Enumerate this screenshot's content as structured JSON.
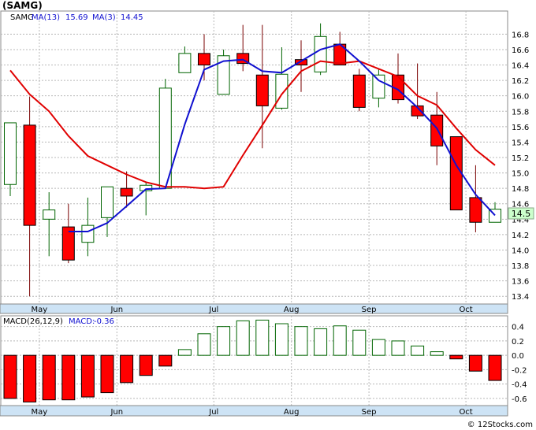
{
  "chart_data": [
    {
      "type": "candlestick",
      "title": "(SAMG)",
      "legend": [
        {
          "label": "SAMG",
          "value": "",
          "color": "#000000"
        },
        {
          "label": "MA(13)",
          "value": "15.69",
          "color": "#e00000"
        },
        {
          "label": "MA(3)",
          "value": "14.45",
          "color": "#1010d0"
        }
      ],
      "last_price_label": "14.5",
      "ylim": [
        13.3,
        17.1
      ],
      "yticks": [
        "13.4",
        "13.6",
        "13.8",
        "14.0",
        "14.2",
        "14.4",
        "14.6",
        "14.8",
        "15.0",
        "15.2",
        "15.4",
        "15.6",
        "15.8",
        "16.0",
        "16.2",
        "16.4",
        "16.6",
        "16.8"
      ],
      "months": [
        "May",
        "Jun",
        "Jul",
        "Aug",
        "Sep",
        "Oct"
      ],
      "month_index": [
        1,
        5,
        10,
        14,
        18,
        23
      ],
      "colors": {
        "up_fill": "#ffffff",
        "up_border": "#006400",
        "down_fill": "#ff0000",
        "ma13": "#e00000",
        "ma3": "#1010d0",
        "label_bg": "#ccffcc"
      },
      "candles": [
        {
          "o": 14.85,
          "h": 15.65,
          "l": 14.7,
          "c": 15.65
        },
        {
          "o": 15.62,
          "h": 15.99,
          "l": 13.4,
          "c": 14.32
        },
        {
          "o": 14.4,
          "h": 14.75,
          "l": 13.92,
          "c": 14.52
        },
        {
          "o": 14.3,
          "h": 14.6,
          "l": 13.83,
          "c": 13.87
        },
        {
          "o": 14.1,
          "h": 14.68,
          "l": 13.92,
          "c": 14.32
        },
        {
          "o": 14.42,
          "h": 14.82,
          "l": 14.17,
          "c": 14.82
        },
        {
          "o": 14.8,
          "h": 15.02,
          "l": 14.55,
          "c": 14.7
        },
        {
          "o": 14.77,
          "h": 14.88,
          "l": 14.45,
          "c": 14.84
        },
        {
          "o": 14.8,
          "h": 16.22,
          "l": 14.8,
          "c": 16.1
        },
        {
          "o": 16.3,
          "h": 16.64,
          "l": 16.3,
          "c": 16.55
        },
        {
          "o": 16.55,
          "h": 16.8,
          "l": 16.2,
          "c": 16.4
        },
        {
          "o": 16.02,
          "h": 16.6,
          "l": 16.02,
          "c": 16.52
        },
        {
          "o": 16.55,
          "h": 16.92,
          "l": 16.32,
          "c": 16.42
        },
        {
          "o": 16.27,
          "h": 16.92,
          "l": 15.32,
          "c": 15.87
        },
        {
          "o": 15.84,
          "h": 16.63,
          "l": 15.82,
          "c": 16.28
        },
        {
          "o": 16.47,
          "h": 16.72,
          "l": 16.05,
          "c": 16.4
        },
        {
          "o": 16.31,
          "h": 16.94,
          "l": 16.27,
          "c": 16.77
        },
        {
          "o": 16.67,
          "h": 16.83,
          "l": 16.42,
          "c": 16.4
        },
        {
          "o": 16.27,
          "h": 16.35,
          "l": 15.8,
          "c": 15.85
        },
        {
          "o": 15.97,
          "h": 16.35,
          "l": 15.85,
          "c": 16.27
        },
        {
          "o": 16.27,
          "h": 16.55,
          "l": 15.9,
          "c": 15.95
        },
        {
          "o": 15.87,
          "h": 16.42,
          "l": 15.7,
          "c": 15.74
        },
        {
          "o": 15.75,
          "h": 16.05,
          "l": 15.1,
          "c": 15.35
        },
        {
          "o": 15.47,
          "h": 15.47,
          "l": 14.52,
          "c": 14.52
        },
        {
          "o": 14.68,
          "h": 15.1,
          "l": 14.23,
          "c": 14.36
        },
        {
          "o": 14.36,
          "h": 14.62,
          "l": 14.36,
          "c": 14.53
        }
      ],
      "ma13": [
        16.33,
        16.02,
        15.8,
        15.48,
        15.22,
        15.1,
        14.98,
        14.88,
        14.82,
        14.82,
        14.8,
        14.6,
        14.9
      ],
      "ma3_offset": 3,
      "ma3": [
        14.24,
        14.24,
        14.35,
        14.57,
        14.79,
        14.8,
        15.63
      ],
      "ma13_full": [
        16.33,
        16.02,
        15.8,
        15.48,
        15.22,
        15.1,
        14.98,
        14.88,
        14.82,
        14.82,
        14.8,
        14.82,
        15.23,
        15.62,
        16.02,
        16.32,
        16.45,
        16.42,
        16.45,
        16.35,
        16.25,
        16.0,
        15.88,
        15.58,
        15.3,
        15.1
      ],
      "ma3_full": [
        null,
        null,
        null,
        14.24,
        14.24,
        14.35,
        14.57,
        14.79,
        14.8,
        15.63,
        16.34,
        16.45,
        16.47,
        16.32,
        16.3,
        16.45,
        16.6,
        16.67,
        16.45,
        16.2,
        16.08,
        15.85,
        15.58,
        15.1,
        14.72,
        14.45
      ]
    },
    {
      "type": "bar",
      "title": "MACD(26,12,9)",
      "legend": [
        {
          "label": "MACD:",
          "value": "-0.36",
          "color": "#1010d0"
        }
      ],
      "ylim": [
        -0.7,
        0.55
      ],
      "yticks": [
        "0.4",
        "0.2",
        "0.0",
        "-0.2",
        "-0.4",
        "-0.6"
      ],
      "months": [
        "May",
        "Jun",
        "Jul",
        "Aug",
        "Sep",
        "Oct"
      ],
      "values": [
        -0.6,
        -0.65,
        -0.62,
        -0.62,
        -0.58,
        -0.52,
        -0.38,
        -0.28,
        -0.15,
        0.08,
        0.3,
        0.4,
        0.48,
        0.49,
        0.44,
        0.4,
        0.37,
        0.41,
        0.35,
        0.22,
        0.2,
        0.13,
        0.05,
        -0.05,
        -0.22,
        -0.35,
        -0.36
      ]
    }
  ],
  "footer": {
    "copyright": "© 12Stocks.com"
  }
}
